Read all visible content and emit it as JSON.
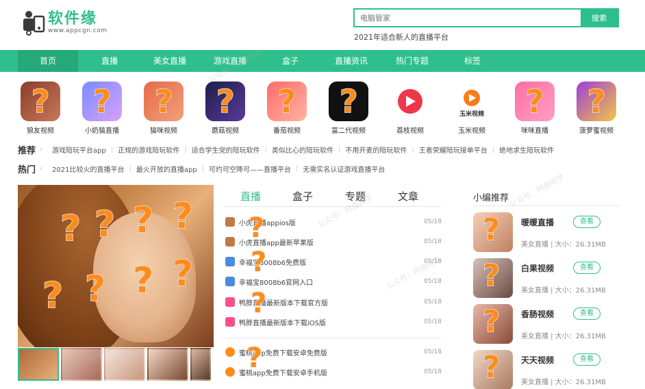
{
  "brand": {
    "name": "软件缘",
    "url": "www.appcgn.com"
  },
  "search": {
    "placeholder": "电脑管家",
    "button": "搜索",
    "hint": "2021年适合新人的直播平台"
  },
  "nav": [
    "首页",
    "直播",
    "美女直播",
    "游戏直播",
    "盒子",
    "直播资讯",
    "热门专题",
    "标签"
  ],
  "apps": [
    "狼友视频",
    "小奶猫直播",
    "猫咪视频",
    "蘑菇视频",
    "番茄视频",
    "富二代视频",
    "荔枝视频",
    "玉米视频",
    "咪咪直播",
    "菠萝蜜视频"
  ],
  "recommend": {
    "title": "推荐",
    "links": [
      "游戏陪玩平台app",
      "正规的游戏陪玩软件",
      "适合学生党的陪玩软件",
      "类似比心的陪玩软件",
      "不用开麦的陪玩软件",
      "王者荣耀陪玩接单平台",
      "绝地求生陪玩软件"
    ]
  },
  "hot": {
    "title": "热门",
    "links": [
      "2021比较火的直播平台",
      "最火开放的直播app",
      "可约可空降可——直播平台",
      "无需实名认证游戏直播平台"
    ]
  },
  "tabs": [
    "直播",
    "盒子",
    "专题",
    "文章"
  ],
  "news": [
    {
      "title": "小虎直播appios版",
      "date": "05/18"
    },
    {
      "title": "小虎直播app最新苹果版",
      "date": "05/18"
    },
    {
      "title": "幸福宝8008b6免费版",
      "date": "05/18"
    },
    {
      "title": "幸福宝8008b6官网入口",
      "date": "05/18"
    },
    {
      "title": "鸭脖直播最新版本下载官方版",
      "date": "05/18"
    },
    {
      "title": "鸭脖直播最新版本下载iOS版",
      "date": "05/18"
    },
    {
      "title": "蜜桃app免费下载安卓免费版",
      "date": "05/18"
    },
    {
      "title": "蜜桃app免费下载安卓手机版",
      "date": "05/18"
    }
  ],
  "side": {
    "title": "小编推荐",
    "button": "查看",
    "items": [
      {
        "name": "暖暖直播",
        "meta": "美女直播 | 大小：26.31MB"
      },
      {
        "name": "白果视频",
        "meta": "美女直播 | 大小：26.31MB"
      },
      {
        "name": "香肠视频",
        "meta": "美女直播 | 大小：26.31MB"
      },
      {
        "name": "天天视频",
        "meta": "美女直播 | 大小：26.31MB"
      }
    ]
  },
  "watermark": "公众号：网盘网学",
  "colors": {
    "accent": "#2ebf8d",
    "accent_dark": "#25a87a",
    "question": "#ff8c1a"
  }
}
